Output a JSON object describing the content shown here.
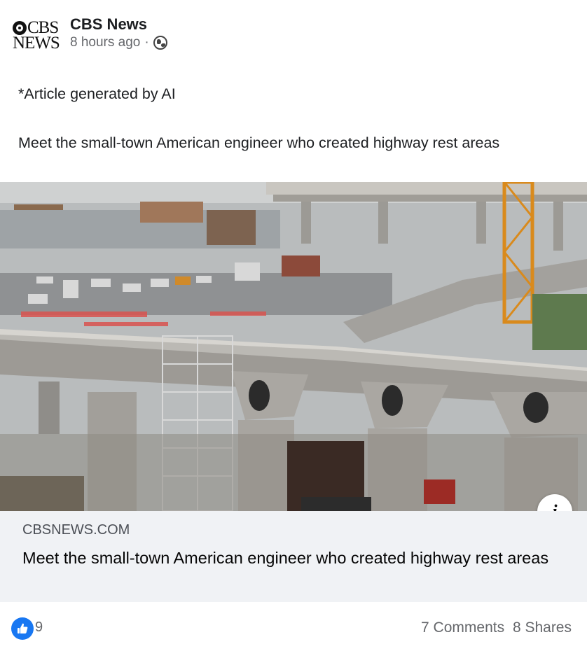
{
  "post": {
    "page_name": "CBS News",
    "logo": {
      "line1": "CBS",
      "line2": "NEWS"
    },
    "timestamp": "8 hours ago",
    "separator": "·",
    "privacy_icon": "globe-icon",
    "text_line1": "*Article generated by AI",
    "text_line2": "Meet the small-town American engineer who created highway rest areas"
  },
  "link_preview": {
    "domain": "CBSNEWS.COM",
    "title": "Meet the small-town American engineer who created highway rest areas",
    "info_label": "i"
  },
  "engagement": {
    "reaction_icon": "thumbs-up-icon",
    "reactions": "9",
    "comments": "7 Comments",
    "shares": "8 Shares"
  },
  "colors": {
    "accent": "#1877f2",
    "link_box_bg": "#f0f2f5",
    "meta_text": "#65676b"
  }
}
